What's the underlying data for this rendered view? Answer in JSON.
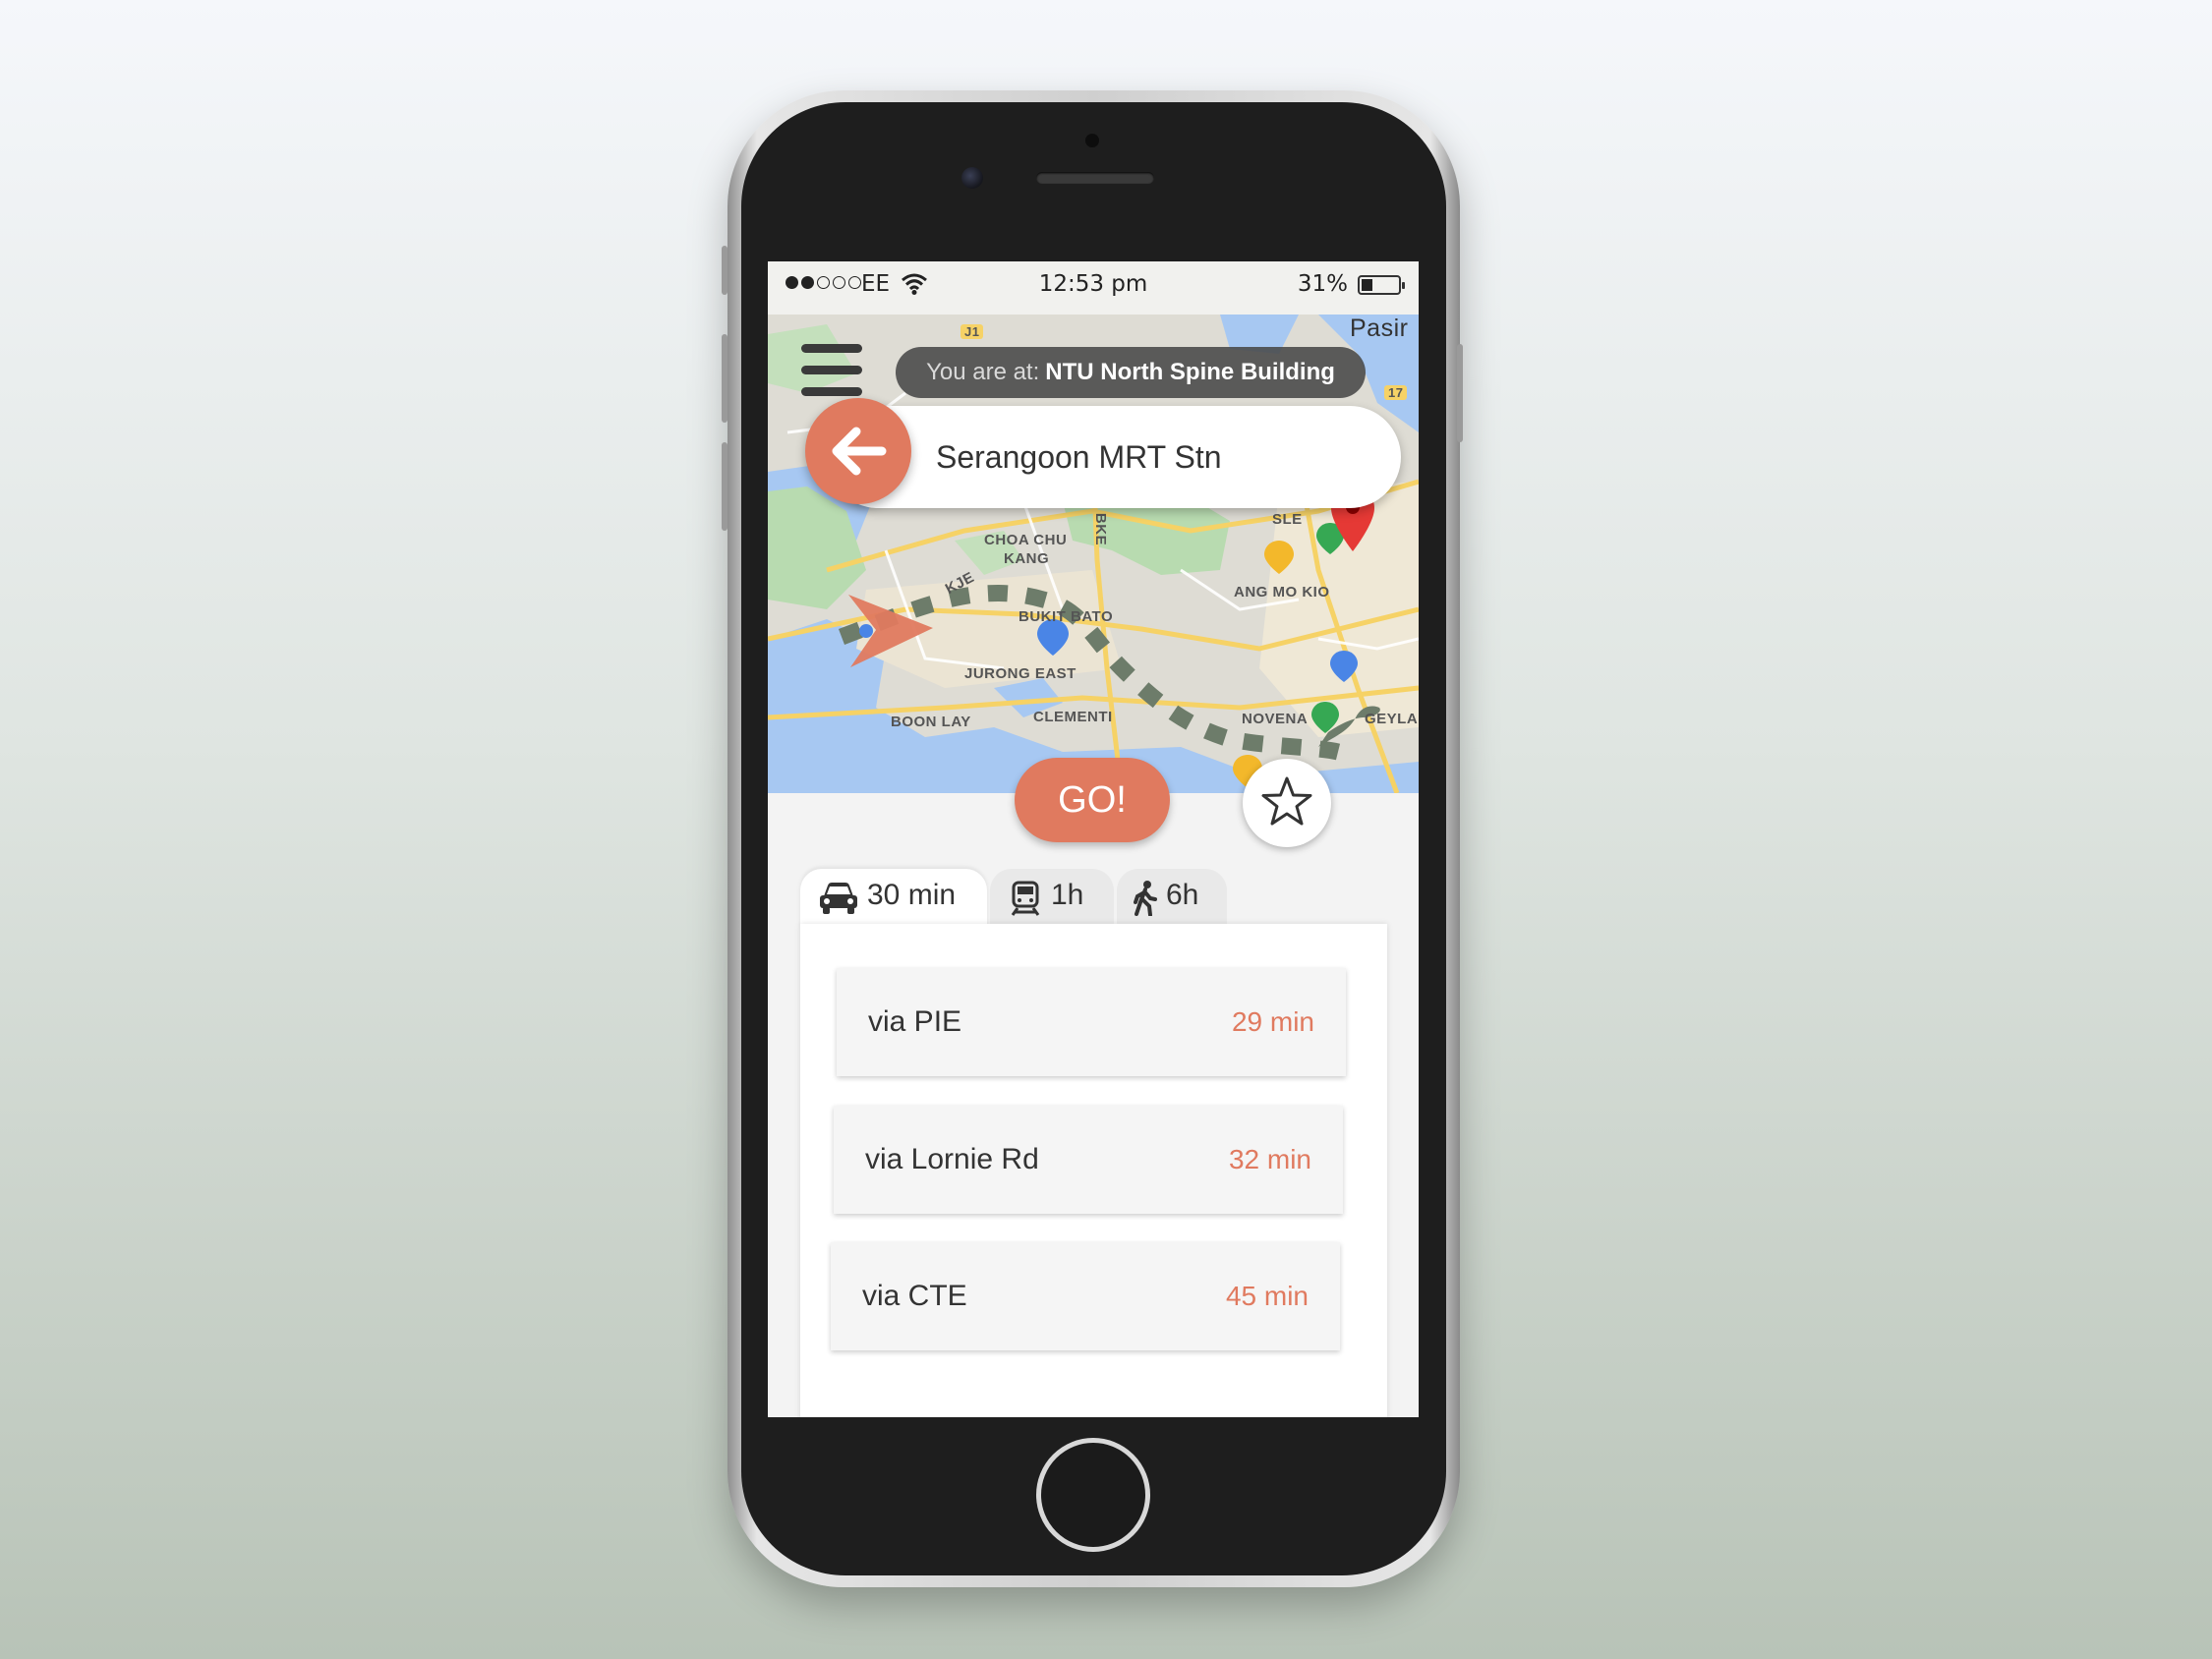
{
  "status_bar": {
    "carrier": "EE",
    "time": "12:53 pm",
    "battery": "31%",
    "battery_level": 0.31
  },
  "map": {
    "location_prefix": "You are at:",
    "location_name": "NTU North Spine Building",
    "labels": {
      "pasir": "Pasir",
      "choa_chu_kang": "CHOA CHU",
      "choa_chu_kang_2": "KANG",
      "bukit_batok": "BUKIT BATO",
      "jurong_east": "JURONG EAST",
      "clementi": "CLEMENTI",
      "boon_lay": "BOON LAY",
      "ang_mo_kio": "ANG MO KIO",
      "novena": "NOVENA",
      "geylang": "GEYLA",
      "sle": "SLE",
      "kje": "KJE",
      "bke": "BKE",
      "j1": "J1",
      "exit_17": "17"
    }
  },
  "destination": {
    "text": "Serangoon MRT Stn"
  },
  "actions": {
    "go_label": "GO!"
  },
  "tabs": [
    {
      "icon": "car-icon",
      "label": "30 min"
    },
    {
      "icon": "train-icon",
      "label": "1h"
    },
    {
      "icon": "walk-icon",
      "label": "6h"
    }
  ],
  "routes": [
    {
      "name": "via PIE",
      "time": "29 min"
    },
    {
      "name": "via Lornie Rd",
      "time": "32 min"
    },
    {
      "name": "via CTE",
      "time": "45 min"
    }
  ],
  "colors": {
    "accent": "#e07a5f",
    "route_line": "#6d7c6a"
  }
}
